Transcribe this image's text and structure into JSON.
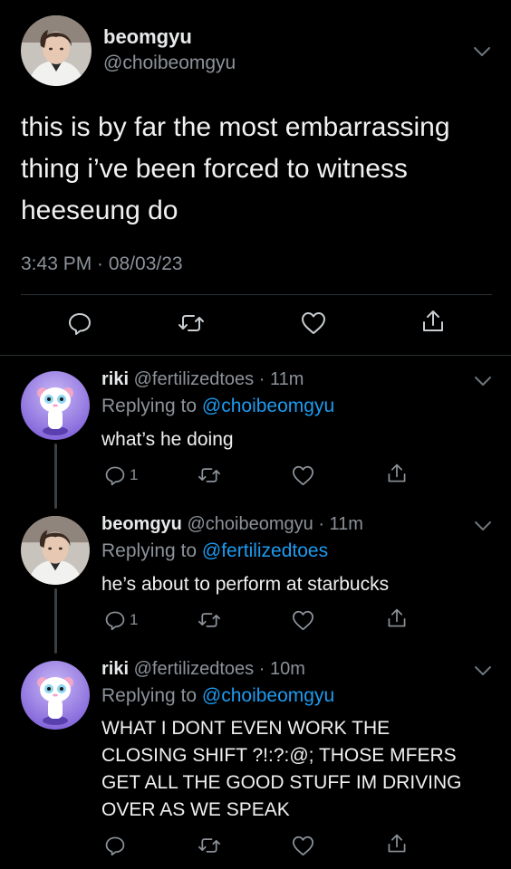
{
  "main_tweet": {
    "display_name": "beomgyu",
    "handle": "@choibeomgyu",
    "text_lines": [
      "this is by far the most embarrassing",
      "thing i’ve been forced to witness",
      "heeseung do"
    ],
    "timestamp": "3:43 PM · 08/03/23",
    "actions": [
      "reply-icon",
      "retweet-icon",
      "like-icon",
      "share-icon"
    ]
  },
  "replies": [
    {
      "display_name": "riki",
      "handle": "@fertilizedtoes",
      "time": "· 11m",
      "replying_prefix": "Replying to ",
      "replying_to": "@choibeomgyu",
      "text_lines": [
        "what’s he doing"
      ],
      "reply_count": "1"
    },
    {
      "display_name": "beomgyu",
      "handle": "@choibeomgyu",
      "time": "· 11m",
      "replying_prefix": "Replying to ",
      "replying_to": "@fertilizedtoes",
      "text_lines": [
        "he’s about to perform at starbucks"
      ],
      "reply_count": "1"
    },
    {
      "display_name": "riki",
      "handle": "@fertilizedtoes",
      "time": "· 10m",
      "replying_prefix": "Replying to ",
      "replying_to": "@choibeomgyu",
      "text_lines": [
        "WHAT I DONT EVEN WORK THE",
        "CLOSING SHIFT ?!:?:@; THOSE MFERS",
        "GET ALL THE GOOD STUFF IM DRIVING",
        "OVER AS WE SPEAK"
      ],
      "reply_count": ""
    }
  ],
  "colors": {
    "background": "#000000",
    "text": "#e7e9ea",
    "secondary": "#8b9299",
    "link": "#1d9bf0",
    "divider": "#2b2f33"
  }
}
